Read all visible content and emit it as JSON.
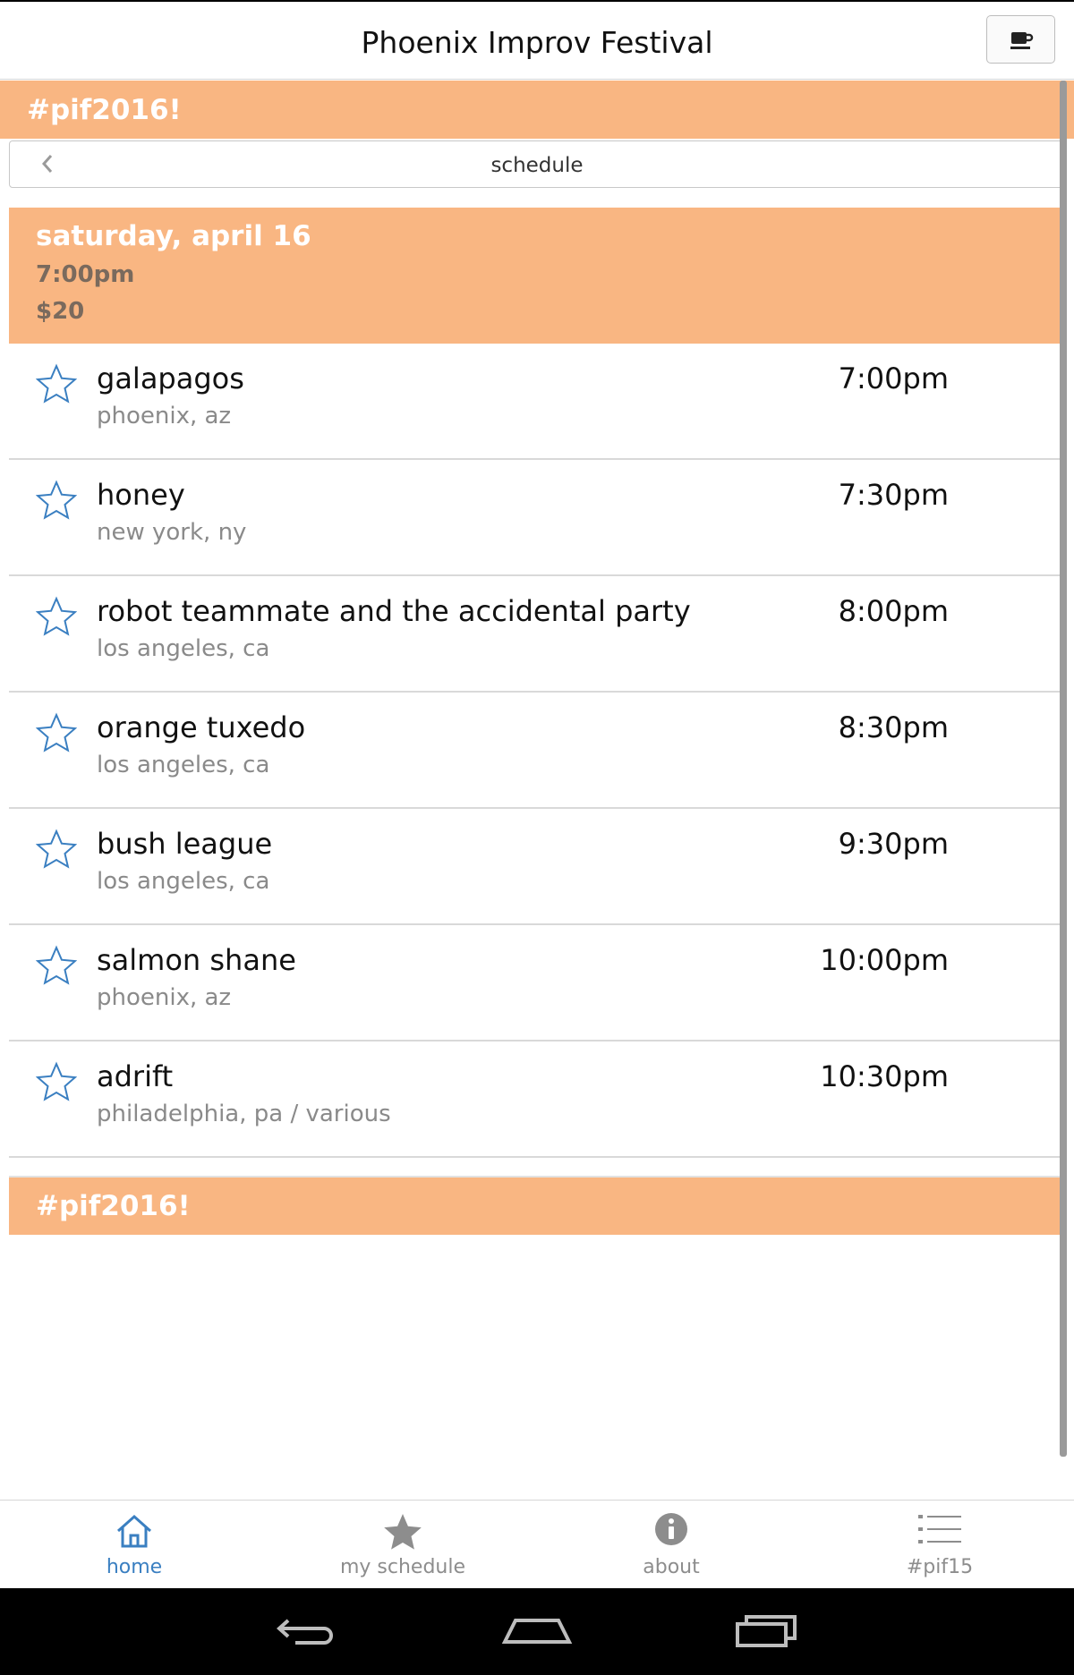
{
  "app": {
    "title": "Phoenix Improv Festival",
    "header_button_icon": "coffee-cup-icon"
  },
  "banner_top": {
    "text": "#pif2016!"
  },
  "nav": {
    "title": "schedule",
    "back_icon": "chevron-left-icon"
  },
  "day": {
    "title": "saturday, april 16",
    "time": "7:00pm",
    "price": "$20"
  },
  "schedule": [
    {
      "name": "galapagos",
      "location": "phoenix, az",
      "time": "7:00pm"
    },
    {
      "name": "honey",
      "location": "new york, ny",
      "time": "7:30pm"
    },
    {
      "name": "robot teammate and the accidental party",
      "location": "los angeles, ca",
      "time": "8:00pm"
    },
    {
      "name": "orange tuxedo",
      "location": "los angeles, ca",
      "time": "8:30pm"
    },
    {
      "name": "bush league",
      "location": "los angeles, ca",
      "time": "9:30pm"
    },
    {
      "name": "salmon shane",
      "location": "phoenix, az",
      "time": "10:00pm"
    },
    {
      "name": "adrift",
      "location": "philadelphia, pa / various",
      "time": "10:30pm"
    }
  ],
  "banner_bottom": {
    "text": "#pif2016!"
  },
  "tabs": [
    {
      "label": "home",
      "icon": "home-icon",
      "active": true
    },
    {
      "label": "my schedule",
      "icon": "star-icon",
      "active": false
    },
    {
      "label": "about",
      "icon": "info-icon",
      "active": false
    },
    {
      "label": "#pif15",
      "icon": "list-icon",
      "active": false
    }
  ],
  "colors": {
    "accent_orange": "#f9b682",
    "active_blue": "#3a7fc1",
    "inactive_gray": "#8d8d8d"
  }
}
